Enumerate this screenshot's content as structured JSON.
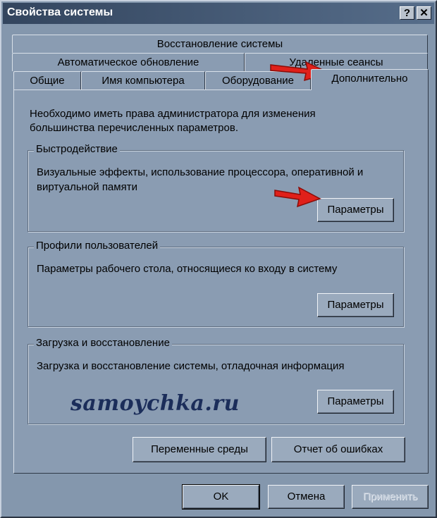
{
  "window": {
    "title": "Свойства системы"
  },
  "titlebar_buttons": {
    "help": "?",
    "close": "✕"
  },
  "tabs": {
    "row1": [
      "Восстановление системы"
    ],
    "row2": [
      "Автоматическое обновление",
      "Удаленные сеансы"
    ],
    "row3": [
      "Общие",
      "Имя компьютера",
      "Оборудование",
      "Дополнительно"
    ],
    "active": "Дополнительно"
  },
  "panel": {
    "note": "Необходимо иметь права администратора для изменения большинства перечисленных параметров."
  },
  "groups": {
    "performance": {
      "title": "Быстродействие",
      "text": "Визуальные эффекты, использование процессора, оперативной и виртуальной памяти",
      "button": "Параметры"
    },
    "profiles": {
      "title": "Профили пользователей",
      "text": "Параметры рабочего стола, относящиеся ко входу в систему",
      "button": "Параметры"
    },
    "startup": {
      "title": "Загрузка и восстановление",
      "text": "Загрузка и восстановление системы, отладочная информация",
      "button": "Параметры"
    }
  },
  "extra_buttons": {
    "env": "Переменные среды",
    "errors": "Отчет об ошибках"
  },
  "watermark": "samoychka.ru",
  "footer": {
    "ok": "OK",
    "cancel": "Отмена",
    "apply": "Применить"
  },
  "colors": {
    "arrow": "#e0201a",
    "titlebar": "#33455e",
    "dialog": "#8a9cb2"
  }
}
